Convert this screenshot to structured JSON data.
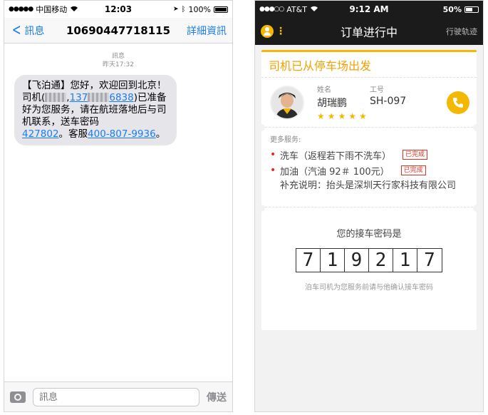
{
  "sms": {
    "status": {
      "carrier": "中国移动",
      "time": "12:03",
      "battery": "100%"
    },
    "nav": {
      "back": "訊息",
      "title": "10690447718115",
      "details": "詳細資訊"
    },
    "meta": {
      "label": "訊息",
      "time": "昨天17:32"
    },
    "message": {
      "p1": "【飞泊通】您好，欢迎回到北京！司机(",
      "p2": ",",
      "phone_a": "137",
      "phone_b": "6838",
      "p3": ")已准备好为您服务，请在航班落地后与司机联系，送车密码",
      "code": "427802",
      "p4": "。客服",
      "hotline": "400-807-9936",
      "p5": "。"
    },
    "input": {
      "placeholder": "訊息",
      "send": "傳送"
    }
  },
  "app": {
    "status": {
      "carrier": "AT&T",
      "time": "9:12 AM",
      "battery": "50%"
    },
    "header": {
      "title": "订单进行中",
      "track": "行驶轨迹"
    },
    "status_title": "司机已从停车场出发",
    "driver": {
      "name_label": "姓名",
      "name": "胡瑞鹏",
      "id_label": "工号",
      "id": "SH-097",
      "rating": 5
    },
    "services": {
      "header": "更多服务:",
      "items": [
        {
          "label": "洗车（返程若下雨不洗车）",
          "status": "已完成"
        },
        {
          "label": "加油（汽油 92＃ 100元）",
          "status": "已完成"
        }
      ],
      "note": "补充说明：抬头是深圳天行家科技有限公司"
    },
    "pickup": {
      "title": "您的接车密码是",
      "digits": [
        "7",
        "1",
        "9",
        "2",
        "1",
        "7"
      ],
      "hint": "泊车司机为您服务前请与他确认接车密码"
    },
    "colors": {
      "accent": "#f5b800",
      "done": "#d32"
    }
  }
}
